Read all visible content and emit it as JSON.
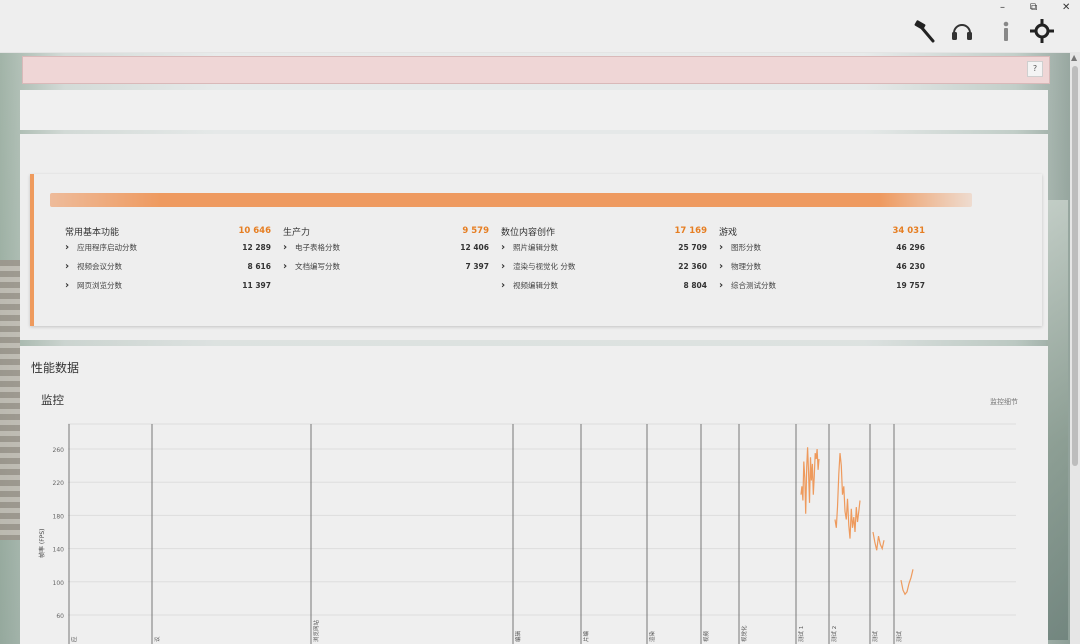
{
  "window": {
    "controls": {
      "restore": "⧉",
      "close": "✕"
    },
    "toolbar_icons": [
      "hammer-icon",
      "headset-icon",
      "info-icon",
      "gear-icon"
    ]
  },
  "banner": {
    "help_label": "?"
  },
  "scores": {
    "categories": [
      {
        "name": "常用基本功能",
        "value": "10 646",
        "rows": [
          {
            "label": "应用程序启动分数",
            "value": "12 289"
          },
          {
            "label": "视频会议分数",
            "value": "8 616"
          },
          {
            "label": "网页浏览分数",
            "value": "11 397"
          }
        ]
      },
      {
        "name": "生产力",
        "value": "9 579",
        "rows": [
          {
            "label": "电子表格分数",
            "value": "12 406"
          },
          {
            "label": "文档编写分数",
            "value": "7 397"
          }
        ]
      },
      {
        "name": "数位内容创作",
        "value": "17 169",
        "rows": [
          {
            "label": "照片编辑分数",
            "value": "25 709"
          },
          {
            "label": "渲染与视觉化 分数",
            "value": "22 360"
          },
          {
            "label": "视频编辑分数",
            "value": "8 804"
          }
        ]
      },
      {
        "name": "游戏",
        "value": "34 031",
        "rows": [
          {
            "label": "图形分数",
            "value": "46 296"
          },
          {
            "label": "物理分数",
            "value": "46 230"
          },
          {
            "label": "综合测试分数",
            "value": "19 757"
          }
        ]
      }
    ]
  },
  "performance": {
    "title": "性能数据",
    "monitor_title": "监控",
    "monitor_link": "监控细节"
  },
  "chart_data": {
    "type": "line",
    "ylabel": "帧率 (FPS)",
    "yticks": [
      260,
      220,
      180,
      140,
      100,
      60
    ],
    "ylim": [
      40,
      290
    ],
    "grid": true,
    "phase_markers": [
      "应",
      "议",
      "浏览网站",
      "编辑",
      "片编",
      "渲染",
      "视频",
      "视觉化",
      "测试 1",
      "测试 2",
      "测试",
      "测试"
    ],
    "color": "#ee9a5d",
    "series": [
      {
        "x": [
          0,
          1,
          2,
          3,
          4,
          5,
          6,
          7,
          8,
          9,
          10,
          11,
          12,
          13,
          14,
          15,
          16,
          17,
          18,
          19
        ],
        "values": [
          205,
          215,
          198,
          245,
          225,
          182,
          238,
          262,
          230,
          195,
          250,
          222,
          242,
          205,
          228,
          255,
          248,
          260,
          235,
          248
        ]
      },
      {
        "x": [
          0,
          1,
          2,
          3,
          4,
          5,
          6,
          7,
          8,
          9,
          10,
          11,
          12,
          13,
          14,
          15,
          16,
          17,
          18,
          19,
          20
        ],
        "values": [
          175,
          165,
          190,
          230,
          255,
          240,
          205,
          215,
          185,
          175,
          200,
          168,
          152,
          188,
          165,
          178,
          160,
          190,
          172,
          185,
          198
        ]
      },
      {
        "x": [
          0,
          1,
          2,
          3,
          4,
          5,
          6
        ],
        "values": [
          160,
          148,
          138,
          155,
          145,
          140,
          150
        ]
      },
      {
        "x": [
          0,
          1,
          2,
          3,
          4,
          5,
          6
        ],
        "values": [
          102,
          90,
          85,
          88,
          98,
          105,
          115
        ]
      }
    ]
  }
}
